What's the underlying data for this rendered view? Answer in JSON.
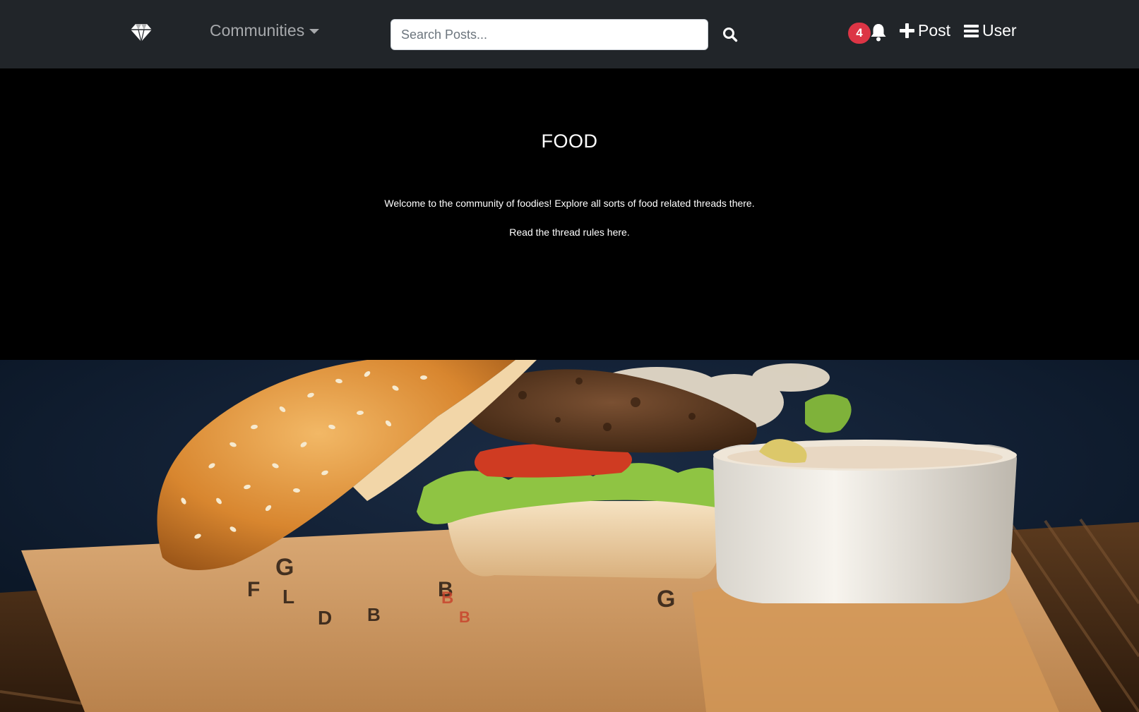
{
  "navbar": {
    "brand_icon": "diamond-icon",
    "communities_label": "Communities",
    "search_placeholder": "Search Posts...",
    "search_icon": "search-icon",
    "notification_count": "4",
    "bell_icon": "bell-icon",
    "post_label": "Post",
    "user_label": "User",
    "colors": {
      "background": "#212529",
      "badge": "#dc3545"
    }
  },
  "community": {
    "title": "FOOD",
    "description": "Welcome to the community of foodies! Explore all sorts of food related threads there.",
    "rules_link": "Read the thread rules here."
  },
  "banner_image": {
    "icon": "burger-photo"
  }
}
